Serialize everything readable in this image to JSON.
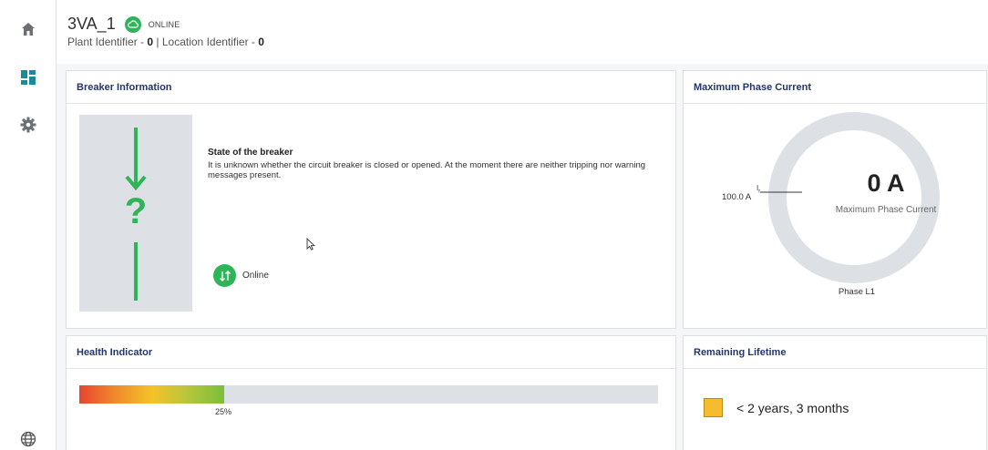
{
  "header": {
    "device_name": "3VA_1",
    "status": "ONLINE",
    "plant_label": "Plant Identifier - ",
    "plant_value": "0",
    "separator": " | ",
    "location_label": "Location Identifier - ",
    "location_value": "0"
  },
  "sidebar": {
    "items": [
      {
        "icon": "home-icon"
      },
      {
        "icon": "dashboard-icon"
      },
      {
        "icon": "gear-icon"
      },
      {
        "icon": "globe-icon"
      }
    ]
  },
  "breaker_info": {
    "title": "Breaker Information",
    "state_title": "State of the breaker",
    "state_text": "It is unknown whether the circuit breaker is closed or opened. At the moment there are neither tripping nor warning messages present.",
    "online_label": "Online",
    "symbol": "?"
  },
  "max_phase_current": {
    "title": "Maximum Phase Current",
    "value": "0 A",
    "sub_label": "Maximum Phase Current",
    "ir_label": "Ir",
    "ir_value": "100.0 A",
    "phase": "Phase L1"
  },
  "health_indicator": {
    "title": "Health Indicator",
    "percent_label": "25%",
    "percent": 25
  },
  "remaining_lifetime": {
    "title": "Remaining Lifetime",
    "text": "< 2 years, 3 months",
    "color": "#f5bd2e"
  },
  "colors": {
    "accent_green": "#2fb45a",
    "title_blue": "#23356b"
  }
}
